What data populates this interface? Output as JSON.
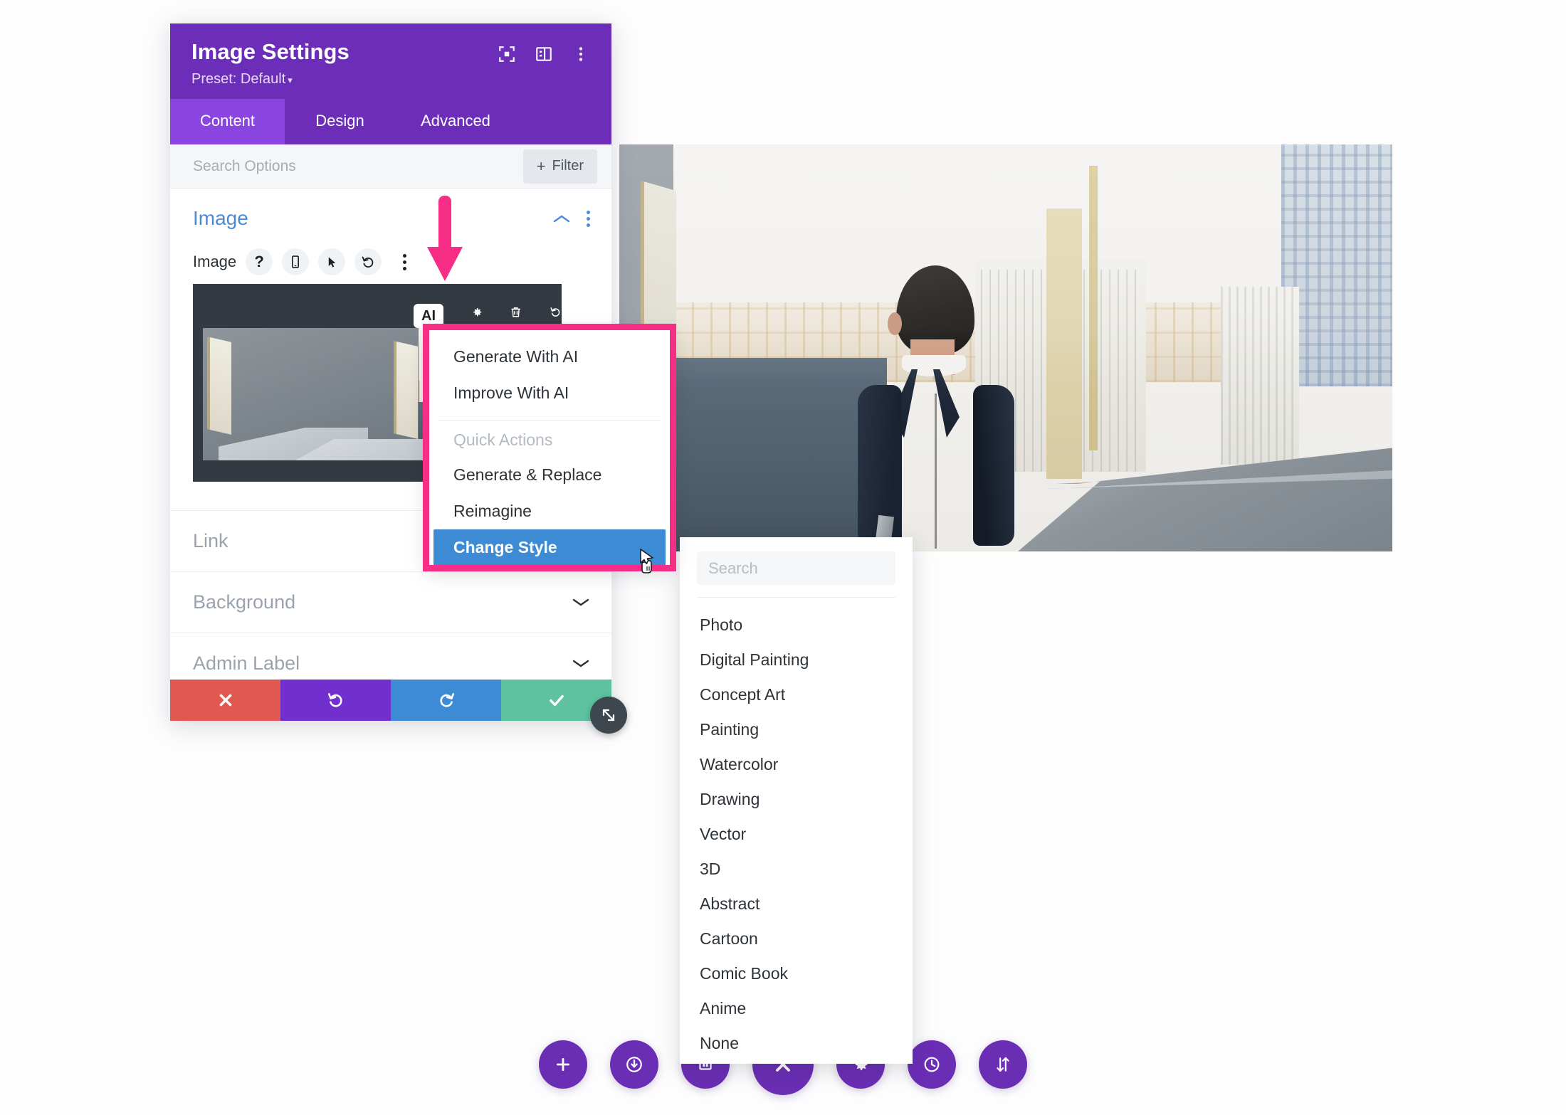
{
  "panel": {
    "title": "Image Settings",
    "preset": "Preset: Default",
    "preset_caret": "▾",
    "header_icons": [
      "focus-target-icon",
      "layout-panel-icon",
      "more-vertical-icon"
    ],
    "tabs": [
      {
        "label": "Content",
        "active": true
      },
      {
        "label": "Design",
        "active": false
      },
      {
        "label": "Advanced",
        "active": false
      }
    ],
    "search": {
      "placeholder": "Search Options"
    },
    "filter_button": {
      "plus": "+",
      "label": "Filter"
    },
    "sections": {
      "image": {
        "title": "Image",
        "field_label": "Image",
        "field_icons": [
          "help-icon",
          "responsive-mobile-icon",
          "hover-cursor-icon",
          "reset-icon",
          "more-vertical-icon"
        ],
        "toolbar": {
          "ai_label": "AI",
          "icons": [
            "gear-icon",
            "trash-icon",
            "undo-icon"
          ]
        }
      },
      "rows": [
        {
          "label": "Link",
          "chevron": false
        },
        {
          "label": "Background",
          "chevron": true
        },
        {
          "label": "Admin Label",
          "chevron": true
        }
      ]
    },
    "footer_buttons": [
      {
        "name": "cancel",
        "icon": "close-x-icon"
      },
      {
        "name": "undo",
        "icon": "undo-arrow-icon"
      },
      {
        "name": "redo",
        "icon": "redo-arrow-icon"
      },
      {
        "name": "save",
        "icon": "checkmark-icon"
      }
    ],
    "resize_handle_icon": "resize-diagonal-icon"
  },
  "ai_menu": {
    "items": [
      {
        "label": "Generate With AI",
        "selected": false
      },
      {
        "label": "Improve With AI",
        "selected": false
      }
    ],
    "group_label": "Quick Actions",
    "quick_actions": [
      {
        "label": "Generate & Replace",
        "selected": false
      },
      {
        "label": "Reimagine",
        "selected": false
      },
      {
        "label": "Change Style",
        "selected": true
      }
    ]
  },
  "style_menu": {
    "search_placeholder": "Search",
    "options": [
      "Photo",
      "Digital Painting",
      "Concept Art",
      "Painting",
      "Watercolor",
      "Drawing",
      "Vector",
      "3D",
      "Abstract",
      "Cartoon",
      "Comic Book",
      "Anime",
      "None"
    ]
  },
  "bottom_toolbar": {
    "buttons": [
      {
        "name": "add-module-button",
        "icon": "plus-icon",
        "big": false
      },
      {
        "name": "save-button",
        "icon": "save-power-icon",
        "big": false
      },
      {
        "name": "layers-button",
        "icon": "layers-icon",
        "big": false
      },
      {
        "name": "close-builder-button",
        "icon": "close-x-icon",
        "big": true
      },
      {
        "name": "settings-button",
        "icon": "gear-icon",
        "big": false
      },
      {
        "name": "history-button",
        "icon": "clock-history-icon",
        "big": false
      },
      {
        "name": "responsive-button",
        "icon": "sort-arrows-icon",
        "big": false
      }
    ]
  },
  "callout": {
    "arrow_color": "#f72e86",
    "box_color": "#f72e86"
  },
  "colors": {
    "panel_header": "#6c2eb9",
    "tab_active": "#8a45e0",
    "section_title": "#4b8bd6",
    "menu_selected": "#3d8bd4",
    "cancel": "#e0584f",
    "undo": "#7130cd",
    "redo": "#3d8bd4",
    "save": "#5ec2a0",
    "toolbar": "#6a2eb5"
  }
}
